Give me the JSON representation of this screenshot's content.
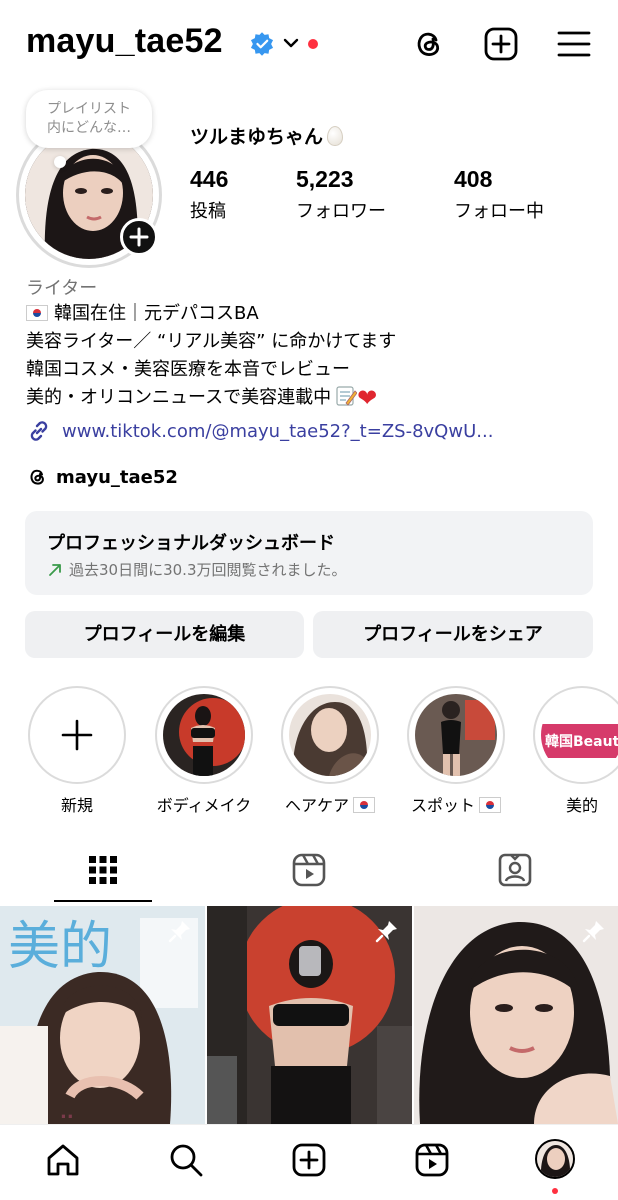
{
  "header": {
    "username": "mayu_tae52",
    "accent_red": "#ff3040",
    "verified_color": "#3797f0"
  },
  "note": {
    "line1": "プレイリスト",
    "line2": "内にどんな…"
  },
  "profile": {
    "display_name": "ツルまゆちゃん",
    "stats": [
      {
        "num": "446",
        "label": "投稿"
      },
      {
        "num": "5,223",
        "label": "フォロワー"
      },
      {
        "num": "408",
        "label": "フォロー中"
      }
    ],
    "category": "ライター",
    "bio": [
      "韓国在住｜元デパコスBA",
      "美容ライター／ “リアル美容” に命かけてます",
      "韓国コスメ・美容医療を本音でレビュー",
      "美的・オリコンニュースで美容連載中"
    ],
    "link": "www.tiktok.com/@mayu_tae52?_t=ZS-8vQwU...",
    "threads": "mayu_tae52"
  },
  "dashboard": {
    "title": "プロフェッショナルダッシュボード",
    "subtitle": "過去30日間に30.3万回閲覧されました。"
  },
  "buttons": {
    "edit": "プロフィールを編集",
    "share": "プロフィールをシェア"
  },
  "highlights": [
    {
      "label": "新規"
    },
    {
      "label": "ボディメイク"
    },
    {
      "label": "ヘアケア"
    },
    {
      "label": "スポット"
    },
    {
      "label": "美的"
    }
  ],
  "grid": {
    "post1_masthead": "美的",
    "post4_text": "韓国Beauty Ta"
  }
}
